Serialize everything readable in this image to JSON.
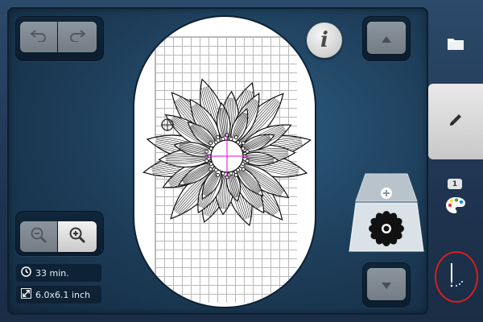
{
  "info": {
    "stitch_time": "33 min.",
    "design_size": "6.0x6.1 inch",
    "info_button_label": "i"
  },
  "sidebar": {
    "color_count": "1"
  },
  "icons": {
    "undo": "undo-arrow-icon",
    "redo": "redo-arrow-icon",
    "zoom_out": "zoom-out-magnifier-icon",
    "zoom_in": "zoom-in-magnifier-icon",
    "clock": "clock-icon",
    "resize": "resize-arrows-icon",
    "folder": "folder-icon",
    "edit": "pencil-icon",
    "palette": "color-palette-icon",
    "stitch": "needle-stitch-icon"
  },
  "colors": {
    "accent_highlight": "#d81e1e",
    "design_center_marker": "#e000e0"
  }
}
